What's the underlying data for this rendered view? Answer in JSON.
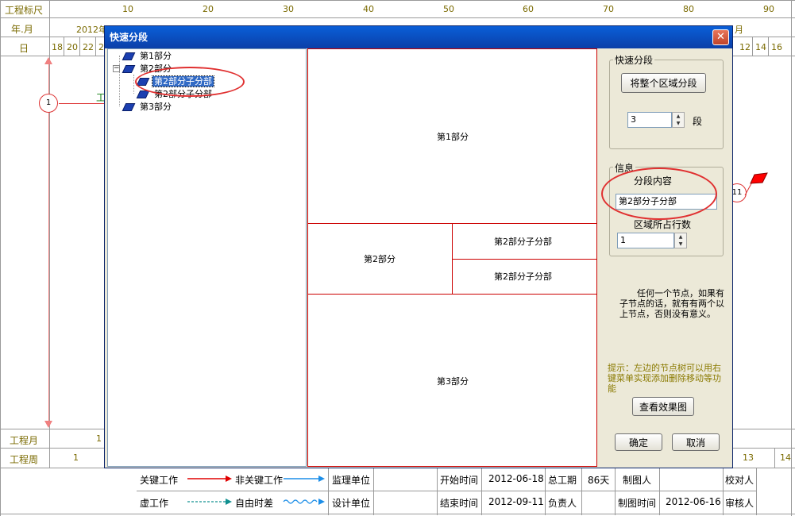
{
  "header": {
    "row1_label": "工程标尺",
    "row2_label": "年.月",
    "row3_label": "日",
    "scale_ticks": [
      "10",
      "20",
      "30",
      "40",
      "50",
      "60",
      "70",
      "80",
      "90"
    ],
    "year_month_left": "2012年",
    "year_month_right": "月",
    "days_left": [
      "18",
      "20",
      "22",
      "2"
    ],
    "days_right": [
      "12",
      "14",
      "16"
    ]
  },
  "chart_bg": {
    "node_left": "1",
    "node_right": "11",
    "task_letter": "工"
  },
  "bottom_rows": {
    "month_label": "工程月",
    "month_value": "1",
    "week_label": "工程周",
    "week_value": "1",
    "week_right_values": [
      "13",
      "14"
    ]
  },
  "dialog": {
    "title": "快速分段",
    "close_label": "✕",
    "tree": [
      {
        "label": "第1部分",
        "expander": ""
      },
      {
        "label": "第2部分",
        "expander": "−"
      },
      {
        "label": "第2部分子分部",
        "selected": true
      },
      {
        "label": "第2部分子分部"
      },
      {
        "label": "第3部分"
      }
    ],
    "preview": {
      "cell_part1": "第1部分",
      "cell_part2": "第2部分",
      "cell_sub1": "第2部分子分部",
      "cell_sub2": "第2部分子分部",
      "cell_part3": "第3部分"
    },
    "quick_split": {
      "group_title": "快速分段",
      "split_all_button": "将整个区域分段",
      "segment_value": "3",
      "segment_unit": "段"
    },
    "info": {
      "group_title": "信息",
      "content_label": "分段内容",
      "content_value": "第2部分子分部",
      "rows_label": "区域所占行数",
      "rows_value": "1"
    },
    "note": "任何一个节点，如果有子节点的话，就有有两个以上节点，否则没有意义。",
    "hint": "提示：左边的节点树可以用右键菜单实现添加删除移动等功能",
    "view_button": "查看效果图",
    "ok_button": "确定",
    "cancel_button": "取消"
  },
  "footer": {
    "critical_work": "关键工作",
    "noncritical_work": "非关键工作",
    "dummy_work": "虚工作",
    "free_float": "自由时差",
    "supervisor_unit": "监理单位",
    "design_unit": "设计单位",
    "start_time_label": "开始时间",
    "start_time_value": "2012-06-18",
    "end_time_label": "结束时间",
    "end_time_value": "2012-09-11",
    "total_duration_label": "总工期",
    "total_duration_value": "86天",
    "responsible_label": "负责人",
    "drawer_label": "制图人",
    "draw_time_label": "制图时间",
    "draw_time_value": "2012-06-16",
    "checker_label": "校对人",
    "reviewer_label": "审核人"
  },
  "colors": {
    "critical_arrow": "#e00000",
    "noncritical_arrow": "#1c8ee8",
    "annotation_circle": "#e03030",
    "title_bar": "#0a5fd8"
  }
}
